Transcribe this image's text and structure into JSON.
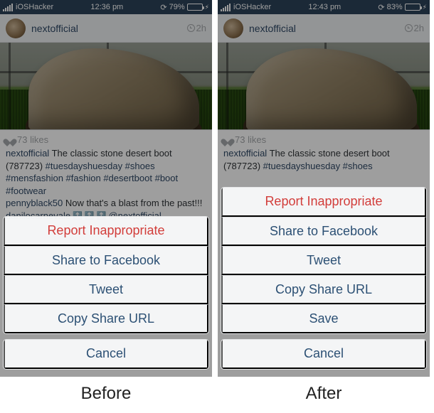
{
  "labels": {
    "before": "Before",
    "after": "After"
  },
  "status": {
    "carrier": "iOSHacker",
    "time_before": "12:36 pm",
    "time_after": "12:43 pm",
    "battery_before": "79%",
    "battery_after": "83%",
    "battery_fill_before": "79%",
    "battery_fill_after": "83%",
    "loading_glyph": "⟳",
    "bolt_glyph": "⚡︎"
  },
  "post": {
    "username": "nextofficial",
    "timestamp": "2h",
    "likes": "73 likes",
    "caption_user": "nextofficial",
    "caption_text": " The classic stone desert boot (787723) ",
    "tags_full": "#tuesdayshuesday #shoes #mensfashion #fashion #desertboot #boot #footwear",
    "tags_short": "#tuesdayshuesday #shoes",
    "comment1_user": "pennyblack50",
    "comment1_text": " Now that's a blast from the past!!!",
    "comment2_user": "danilocarnevale",
    "comment2_emoji": " 🔝 🔝 🔝 ",
    "comment2_mention": "@nextofficial"
  },
  "sheet": {
    "report": "Report Inappropriate",
    "share_fb": "Share to Facebook",
    "tweet": "Tweet",
    "copy_url": "Copy Share URL",
    "save": "Save",
    "cancel": "Cancel"
  }
}
